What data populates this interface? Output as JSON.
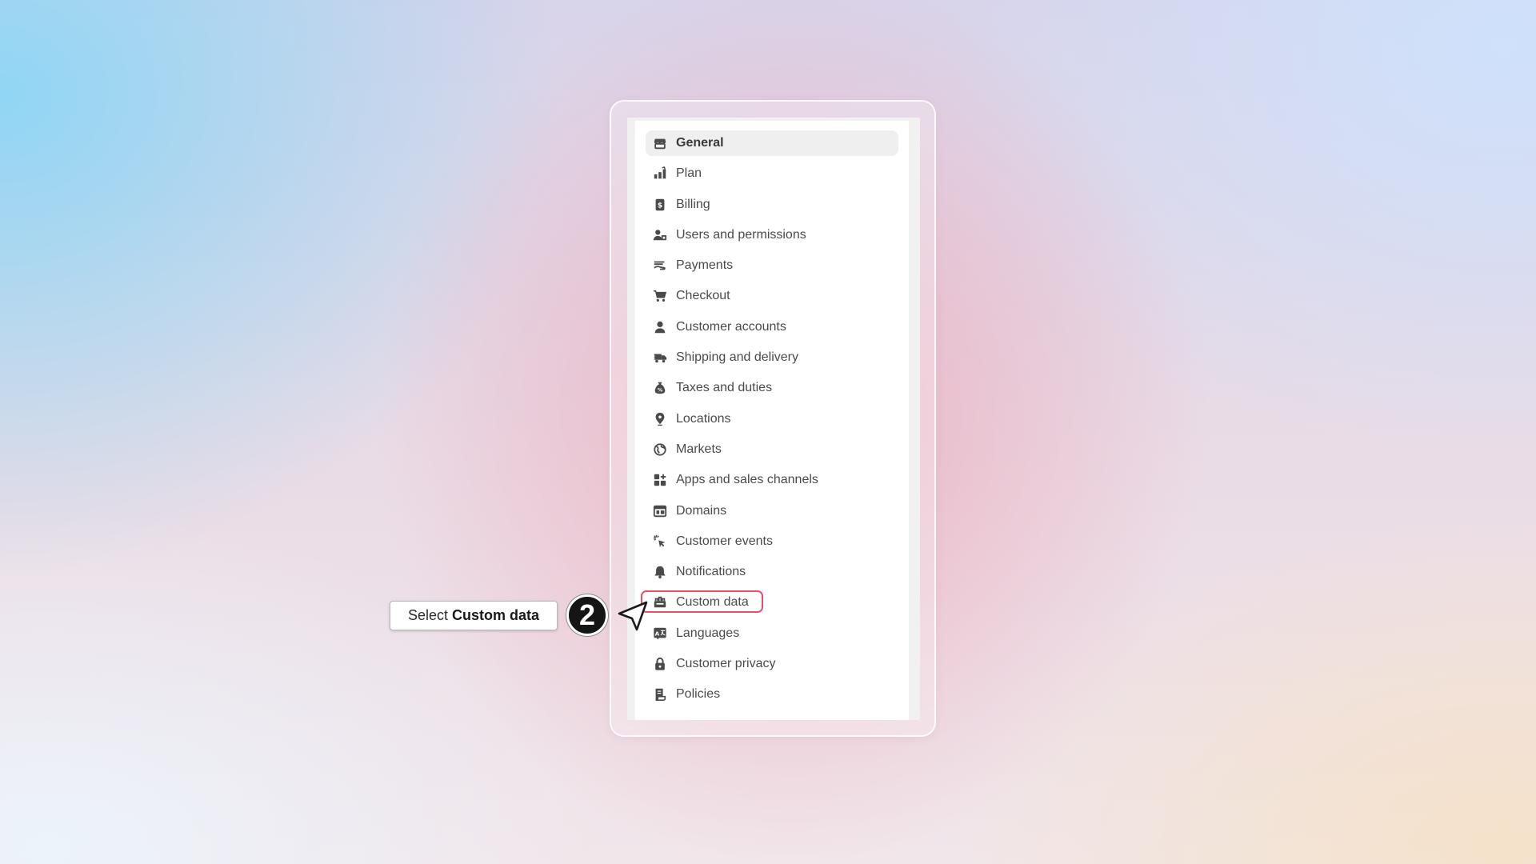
{
  "settings_menu": {
    "items": [
      {
        "label": "General",
        "icon": "store-icon",
        "active": true
      },
      {
        "label": "Plan",
        "icon": "plan-icon"
      },
      {
        "label": "Billing",
        "icon": "billing-icon"
      },
      {
        "label": "Users and permissions",
        "icon": "users-icon"
      },
      {
        "label": "Payments",
        "icon": "payments-icon"
      },
      {
        "label": "Checkout",
        "icon": "cart-icon"
      },
      {
        "label": "Customer accounts",
        "icon": "person-icon"
      },
      {
        "label": "Shipping and delivery",
        "icon": "truck-icon"
      },
      {
        "label": "Taxes and duties",
        "icon": "tax-bag-icon"
      },
      {
        "label": "Locations",
        "icon": "location-pin-icon"
      },
      {
        "label": "Markets",
        "icon": "globe-icon"
      },
      {
        "label": "Apps and sales channels",
        "icon": "apps-icon"
      },
      {
        "label": "Domains",
        "icon": "domains-icon"
      },
      {
        "label": "Customer events",
        "icon": "cursor-click-icon"
      },
      {
        "label": "Notifications",
        "icon": "bell-icon"
      },
      {
        "label": "Custom data",
        "icon": "database-icon",
        "highlighted": true
      },
      {
        "label": "Languages",
        "icon": "language-icon"
      },
      {
        "label": "Customer privacy",
        "icon": "lock-icon"
      },
      {
        "label": "Policies",
        "icon": "policy-scroll-icon"
      }
    ]
  },
  "annotation": {
    "callout_prefix": "Select",
    "callout_bold": "Custom data",
    "step_number": "2",
    "highlight_color": "#ea5060"
  }
}
